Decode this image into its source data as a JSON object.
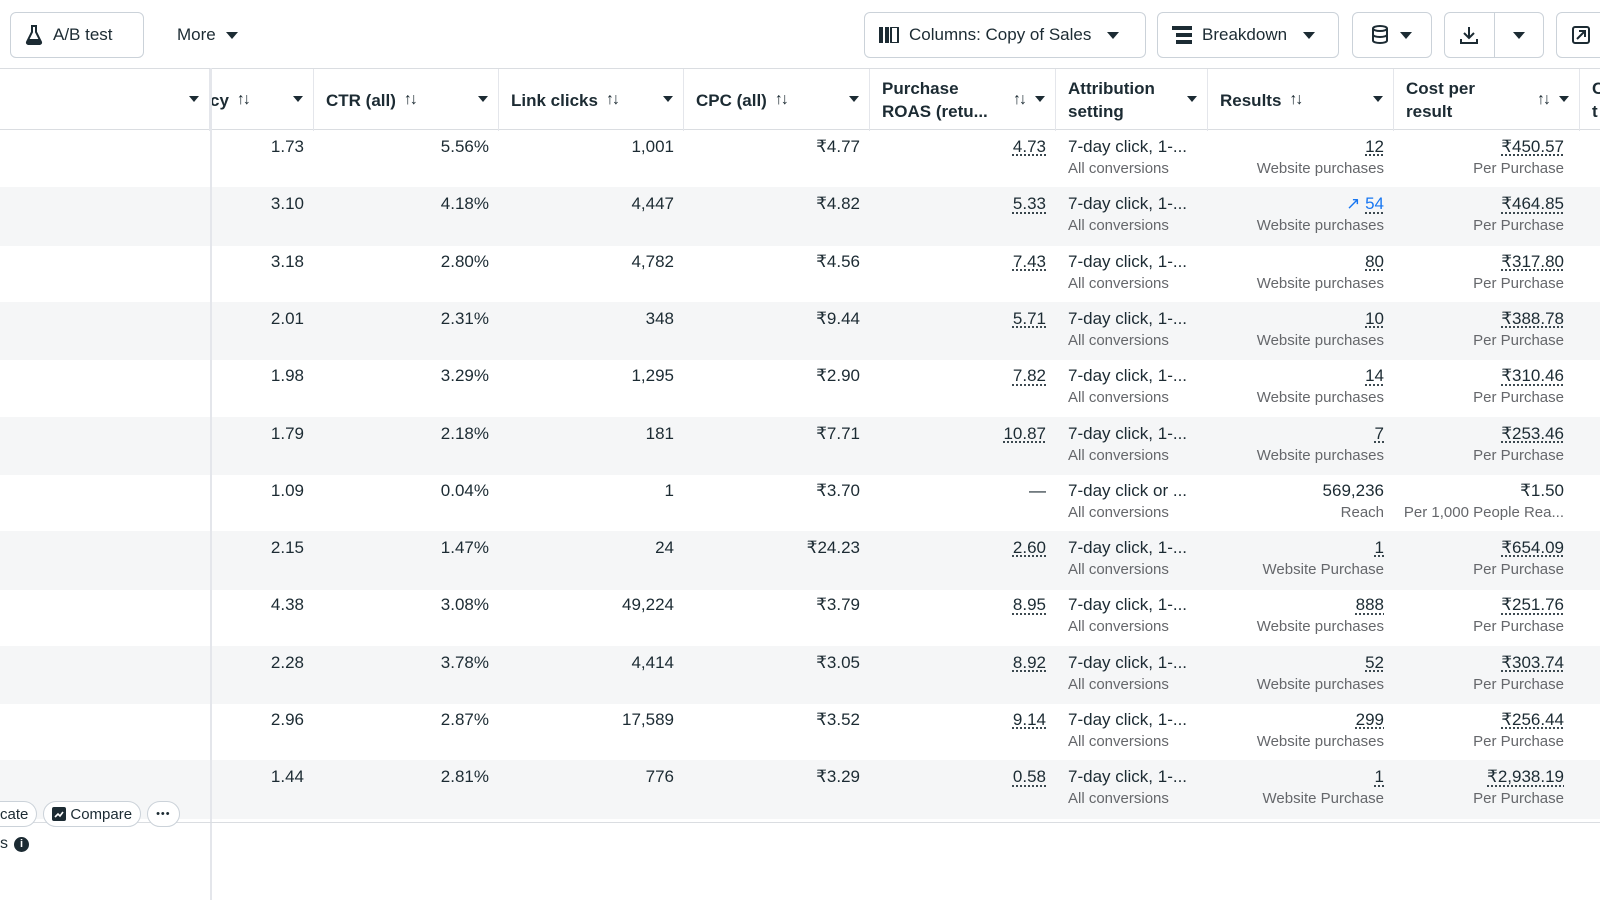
{
  "toolbar": {
    "ab_test_label": "A/B test",
    "more_label": "More",
    "columns_label": "Columns: Copy of Sales",
    "breakdown_label": "Breakdown"
  },
  "columns": {
    "freq_tail": "cy",
    "ctr": "CTR (all)",
    "link_clicks": "Link clicks",
    "cpc": "CPC (all)",
    "roas_line1": "Purchase",
    "roas_line2": "ROAS (retu...",
    "attr_line1": "Attribution",
    "attr_line2": "setting",
    "results": "Results",
    "cpr_line1": "Cost per",
    "cpr_line2": "result",
    "next_line1": "C",
    "next_line2": "t"
  },
  "rows": [
    {
      "freq": "1.73",
      "ctr": "5.56%",
      "clicks": "1,001",
      "cpc": "₹4.77",
      "roas": "4.73",
      "attr": "7-day click, 1-...",
      "attr_sub": "All conversions",
      "results": "12",
      "results_sub": "Website purchases",
      "cpr": "₹450.57",
      "cpr_sub": "Per Purchase"
    },
    {
      "freq": "3.10",
      "ctr": "4.18%",
      "clicks": "4,447",
      "cpc": "₹4.82",
      "roas": "5.33",
      "attr": "7-day click, 1-...",
      "attr_sub": "All conversions",
      "results": "54",
      "results_sub": "Website purchases",
      "cpr": "₹464.85",
      "cpr_sub": "Per Purchase"
    },
    {
      "freq": "3.18",
      "ctr": "2.80%",
      "clicks": "4,782",
      "cpc": "₹4.56",
      "roas": "7.43",
      "attr": "7-day click, 1-...",
      "attr_sub": "All conversions",
      "results": "80",
      "results_sub": "Website purchases",
      "cpr": "₹317.80",
      "cpr_sub": "Per Purchase"
    },
    {
      "freq": "2.01",
      "ctr": "2.31%",
      "clicks": "348",
      "cpc": "₹9.44",
      "roas": "5.71",
      "attr": "7-day click, 1-...",
      "attr_sub": "All conversions",
      "results": "10",
      "results_sub": "Website purchases",
      "cpr": "₹388.78",
      "cpr_sub": "Per Purchase"
    },
    {
      "freq": "1.98",
      "ctr": "3.29%",
      "clicks": "1,295",
      "cpc": "₹2.90",
      "roas": "7.82",
      "attr": "7-day click, 1-...",
      "attr_sub": "All conversions",
      "results": "14",
      "results_sub": "Website purchases",
      "cpr": "₹310.46",
      "cpr_sub": "Per Purchase"
    },
    {
      "freq": "1.79",
      "ctr": "2.18%",
      "clicks": "181",
      "cpc": "₹7.71",
      "roas": "10.87",
      "attr": "7-day click, 1-...",
      "attr_sub": "All conversions",
      "results": "7",
      "results_sub": "Website purchases",
      "cpr": "₹253.46",
      "cpr_sub": "Per Purchase"
    },
    {
      "freq": "1.09",
      "ctr": "0.04%",
      "clicks": "1",
      "cpc": "₹3.70",
      "roas": "—",
      "attr": "7-day click or ...",
      "attr_sub": "All conversions",
      "results": "569,236",
      "results_sub": "Reach",
      "cpr": "₹1.50",
      "cpr_sub": "Per 1,000 People Rea..."
    },
    {
      "freq": "2.15",
      "ctr": "1.47%",
      "clicks": "24",
      "cpc": "₹24.23",
      "roas": "2.60",
      "attr": "7-day click, 1-...",
      "attr_sub": "All conversions",
      "results": "1",
      "results_sub": "Website Purchase",
      "cpr": "₹654.09",
      "cpr_sub": "Per Purchase"
    },
    {
      "freq": "4.38",
      "ctr": "3.08%",
      "clicks": "49,224",
      "cpc": "₹3.79",
      "roas": "8.95",
      "attr": "7-day click, 1-...",
      "attr_sub": "All conversions",
      "results": "888",
      "results_sub": "Website purchases",
      "cpr": "₹251.76",
      "cpr_sub": "Per Purchase"
    },
    {
      "freq": "2.28",
      "ctr": "3.78%",
      "clicks": "4,414",
      "cpc": "₹3.05",
      "roas": "8.92",
      "attr": "7-day click, 1-...",
      "attr_sub": "All conversions",
      "results": "52",
      "results_sub": "Website purchases",
      "cpr": "₹303.74",
      "cpr_sub": "Per Purchase"
    },
    {
      "freq": "2.96",
      "ctr": "2.87%",
      "clicks": "17,589",
      "cpc": "₹3.52",
      "roas": "9.14",
      "attr": "7-day click, 1-...",
      "attr_sub": "All conversions",
      "results": "299",
      "results_sub": "Website purchases",
      "cpr": "₹256.44",
      "cpr_sub": "Per Purchase"
    },
    {
      "freq": "1.44",
      "ctr": "2.81%",
      "clicks": "776",
      "cpc": "₹3.29",
      "roas": "0.58",
      "attr": "7-day click, 1-...",
      "attr_sub": "All conversions",
      "results": "1",
      "results_sub": "Website Purchase",
      "cpr": "₹2,938.19",
      "cpr_sub": "Per Purchase"
    }
  ],
  "row_actions": {
    "duplicate_tail": "cate",
    "compare_label": "Compare",
    "more_glyph": "•••"
  },
  "footnote": {
    "text_tail": "s"
  },
  "icons": {
    "ab_test": "flask-icon",
    "columns": "columns-icon",
    "breakdown": "breakdown-icon",
    "reports": "database-icon",
    "export": "download-icon",
    "share": "share-icon",
    "trend": "trend-up-icon"
  },
  "colors": {
    "accent": "#1877f2",
    "text": "#1c2b33",
    "muted": "#65676b",
    "alt_row": "#f5f6f7"
  }
}
